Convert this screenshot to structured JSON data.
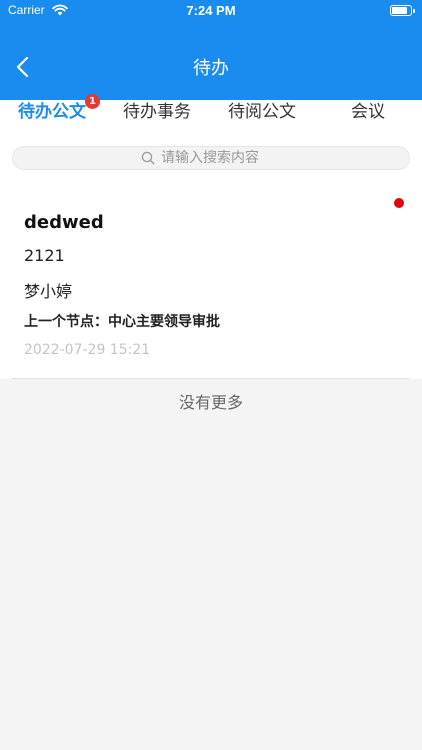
{
  "status_bar": {
    "carrier": "Carrier",
    "time": "7:24 PM"
  },
  "nav": {
    "title": "待办"
  },
  "tabs": [
    {
      "label": "待办公文",
      "badge": "1",
      "active": true
    },
    {
      "label": "待办事务"
    },
    {
      "label": "待阅公文"
    },
    {
      "label": "会议"
    }
  ],
  "search": {
    "placeholder": "请输入搜索内容"
  },
  "items": [
    {
      "title": "dedwed",
      "number": "2121",
      "person": "梦小婷",
      "node": "上一个节点：中心主要领导审批",
      "time": "2022-07-29 15:21",
      "unread": true
    }
  ],
  "footer": {
    "no_more": "没有更多"
  },
  "colors": {
    "primary": "#1a8cf0",
    "badge": "#e53935",
    "unread_dot": "#e8000b",
    "background": "#f4f4f4"
  },
  "icons": {
    "back": "chevron-left-icon",
    "search": "search-icon",
    "wifi": "wifi-icon",
    "battery": "battery-icon"
  }
}
